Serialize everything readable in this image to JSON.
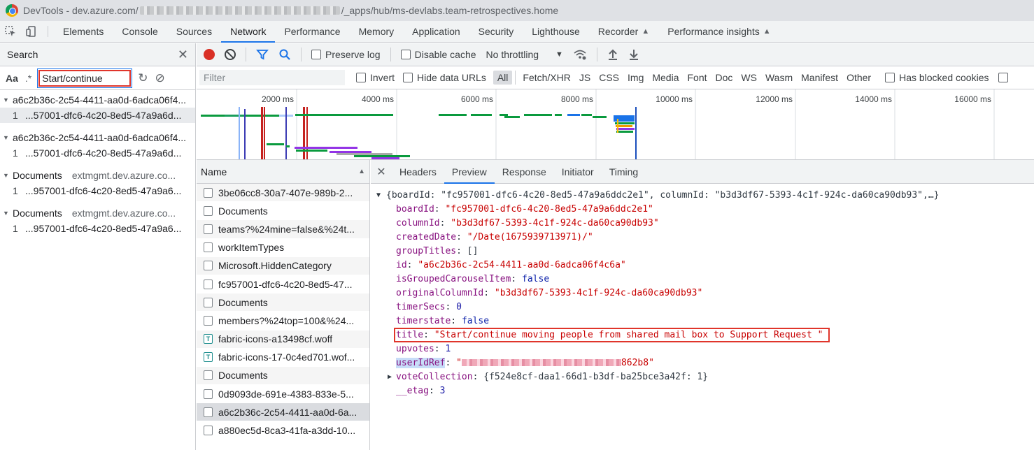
{
  "titlebar": {
    "app": "DevTools - dev.azure.com/",
    "path": "/_apps/hub/ms-devlabs.team-retrospectives.home"
  },
  "main_tabs": [
    {
      "label": "Elements"
    },
    {
      "label": "Console"
    },
    {
      "label": "Sources"
    },
    {
      "label": "Network"
    },
    {
      "label": "Performance"
    },
    {
      "label": "Memory"
    },
    {
      "label": "Application"
    },
    {
      "label": "Security"
    },
    {
      "label": "Lighthouse"
    },
    {
      "label": "Recorder"
    },
    {
      "label": "Performance insights"
    }
  ],
  "active_tab": "Network",
  "search": {
    "title": "Search",
    "case_label": "Aa",
    "regex_label": ".*",
    "query": "Start/continue",
    "results": [
      {
        "file": "a6c2b36c-2c54-4411-aa0d-6adca06f4...",
        "origin": "",
        "line": "1",
        "text": "...57001-dfc6-4c20-8ed5-47a9a6d...",
        "selected": true
      },
      {
        "file": "a6c2b36c-2c54-4411-aa0d-6adca06f4...",
        "origin": "",
        "line": "1",
        "text": "...57001-dfc6-4c20-8ed5-47a9a6d...",
        "selected": false
      },
      {
        "file": "Documents",
        "origin": "extmgmt.dev.azure.co...",
        "line": "1",
        "text": "...957001-dfc6-4c20-8ed5-47a9a6...",
        "selected": false
      },
      {
        "file": "Documents",
        "origin": "extmgmt.dev.azure.co...",
        "line": "1",
        "text": "...957001-dfc6-4c20-8ed5-47a9a6...",
        "selected": false
      }
    ]
  },
  "toolbar": {
    "preserve_log": "Preserve log",
    "disable_cache": "Disable cache",
    "throttling": "No throttling"
  },
  "filterbar": {
    "placeholder": "Filter",
    "invert": "Invert",
    "hide_data_urls": "Hide data URLs",
    "types": [
      "All",
      "Fetch/XHR",
      "JS",
      "CSS",
      "Img",
      "Media",
      "Font",
      "Doc",
      "WS",
      "Wasm",
      "Manifest",
      "Other"
    ],
    "blocked_cookies": "Has blocked cookies"
  },
  "overview": {
    "ticks": [
      "2000 ms",
      "4000 ms",
      "6000 ms",
      "8000 ms",
      "10000 ms",
      "12000 ms",
      "14000 ms",
      "16000 ms"
    ]
  },
  "request_list": {
    "header": "Name",
    "rows": [
      {
        "name": "3be06cc8-30a7-407e-989b-2...",
        "type": "doc"
      },
      {
        "name": "Documents",
        "type": "doc"
      },
      {
        "name": "teams?%24mine=false&%24t...",
        "type": "doc"
      },
      {
        "name": "workItemTypes",
        "type": "doc"
      },
      {
        "name": "Microsoft.HiddenCategory",
        "type": "doc"
      },
      {
        "name": "fc957001-dfc6-4c20-8ed5-47...",
        "type": "doc"
      },
      {
        "name": "Documents",
        "type": "doc"
      },
      {
        "name": "members?%24top=100&%24...",
        "type": "doc"
      },
      {
        "name": "fabric-icons-a13498cf.woff",
        "type": "font"
      },
      {
        "name": "fabric-icons-17-0c4ed701.wof...",
        "type": "font"
      },
      {
        "name": "Documents",
        "type": "doc"
      },
      {
        "name": "0d9093de-691e-4383-833e-5...",
        "type": "doc"
      },
      {
        "name": "a6c2b36c-2c54-4411-aa0d-6a...",
        "type": "doc",
        "selected": true
      },
      {
        "name": "a880ec5d-8ca3-41fa-a3dd-10...",
        "type": "doc"
      }
    ]
  },
  "detail": {
    "tabs": [
      "Headers",
      "Preview",
      "Response",
      "Initiator",
      "Timing"
    ],
    "active": "Preview",
    "summary_line": "{boardId: \"fc957001-dfc6-4c20-8ed5-47a9a6ddc2e1\", columnId: \"b3d3df67-5393-4c1f-924c-da60ca90db93\",…}",
    "fields": [
      {
        "key": "boardId",
        "value": "\"fc957001-dfc6-4c20-8ed5-47a9a6ddc2e1\"",
        "kind": "str"
      },
      {
        "key": "columnId",
        "value": "\"b3d3df67-5393-4c1f-924c-da60ca90db93\"",
        "kind": "str"
      },
      {
        "key": "createdDate",
        "value": "\"/Date(1675939713971)/\"",
        "kind": "str"
      },
      {
        "key": "groupTitles",
        "value": "[]",
        "kind": "plain"
      },
      {
        "key": "id",
        "value": "\"a6c2b36c-2c54-4411-aa0d-6adca06f4c6a\"",
        "kind": "str"
      },
      {
        "key": "isGroupedCarouselItem",
        "value": "false",
        "kind": "kw"
      },
      {
        "key": "originalColumnId",
        "value": "\"b3d3df67-5393-4c1f-924c-da60ca90db93\"",
        "kind": "str"
      },
      {
        "key": "timerSecs",
        "value": "0",
        "kind": "num"
      },
      {
        "key": "timerstate",
        "value": "false",
        "kind": "kw"
      },
      {
        "key": "title",
        "value": "\"Start/continue moving people from shared mail box to Support Request \"",
        "kind": "str"
      },
      {
        "key": "upvotes",
        "value": "1",
        "kind": "num"
      },
      {
        "key": "userIdRef",
        "value_prefix": "\"",
        "value_suffix": "862b8\"",
        "kind": "str"
      },
      {
        "key": "voteCollection",
        "value": "{f524e8cf-daa1-66d1-b3df-ba25bce3a42f: 1}",
        "kind": "plain"
      },
      {
        "key": "__etag",
        "value": "3",
        "kind": "num"
      }
    ]
  },
  "colors": {
    "accent": "#1a73e8",
    "record": "#d93025",
    "highlight_box": "#e0352b"
  }
}
